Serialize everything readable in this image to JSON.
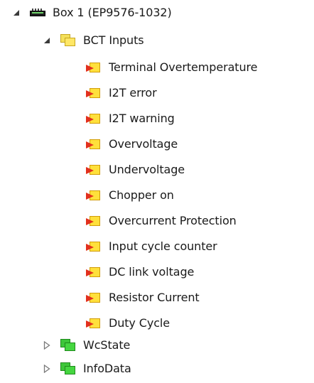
{
  "tree": {
    "box": {
      "label": "Box 1 (EP9576-1032)",
      "expanded": true,
      "icon": "device-box-icon"
    },
    "inputs_group": {
      "label": "BCT Inputs",
      "expanded": true,
      "icon": "folder-yellow-icon",
      "items": [
        {
          "label": "Terminal Overtemperature",
          "icon": "input-variable-icon"
        },
        {
          "label": "I2T error",
          "icon": "input-variable-icon"
        },
        {
          "label": "I2T warning",
          "icon": "input-variable-icon"
        },
        {
          "label": "Overvoltage",
          "icon": "input-variable-icon"
        },
        {
          "label": "Undervoltage",
          "icon": "input-variable-icon"
        },
        {
          "label": "Chopper on",
          "icon": "input-variable-icon"
        },
        {
          "label": "Overcurrent Protection",
          "icon": "input-variable-icon"
        },
        {
          "label": "Input cycle counter",
          "icon": "input-variable-icon"
        },
        {
          "label": "DC link voltage",
          "icon": "input-variable-icon"
        },
        {
          "label": "Resistor Current",
          "icon": "input-variable-icon"
        },
        {
          "label": "Duty Cycle",
          "icon": "input-variable-icon"
        }
      ]
    },
    "collapsed_groups": [
      {
        "label": "WcState",
        "expanded": false,
        "icon": "folder-green-icon"
      },
      {
        "label": "InfoData",
        "expanded": false,
        "icon": "folder-green-icon"
      }
    ]
  },
  "colors": {
    "expanded_toggle": "#3a3a3a",
    "collapsed_toggle": "#7a7a7a",
    "text": "#1a1a1a"
  }
}
